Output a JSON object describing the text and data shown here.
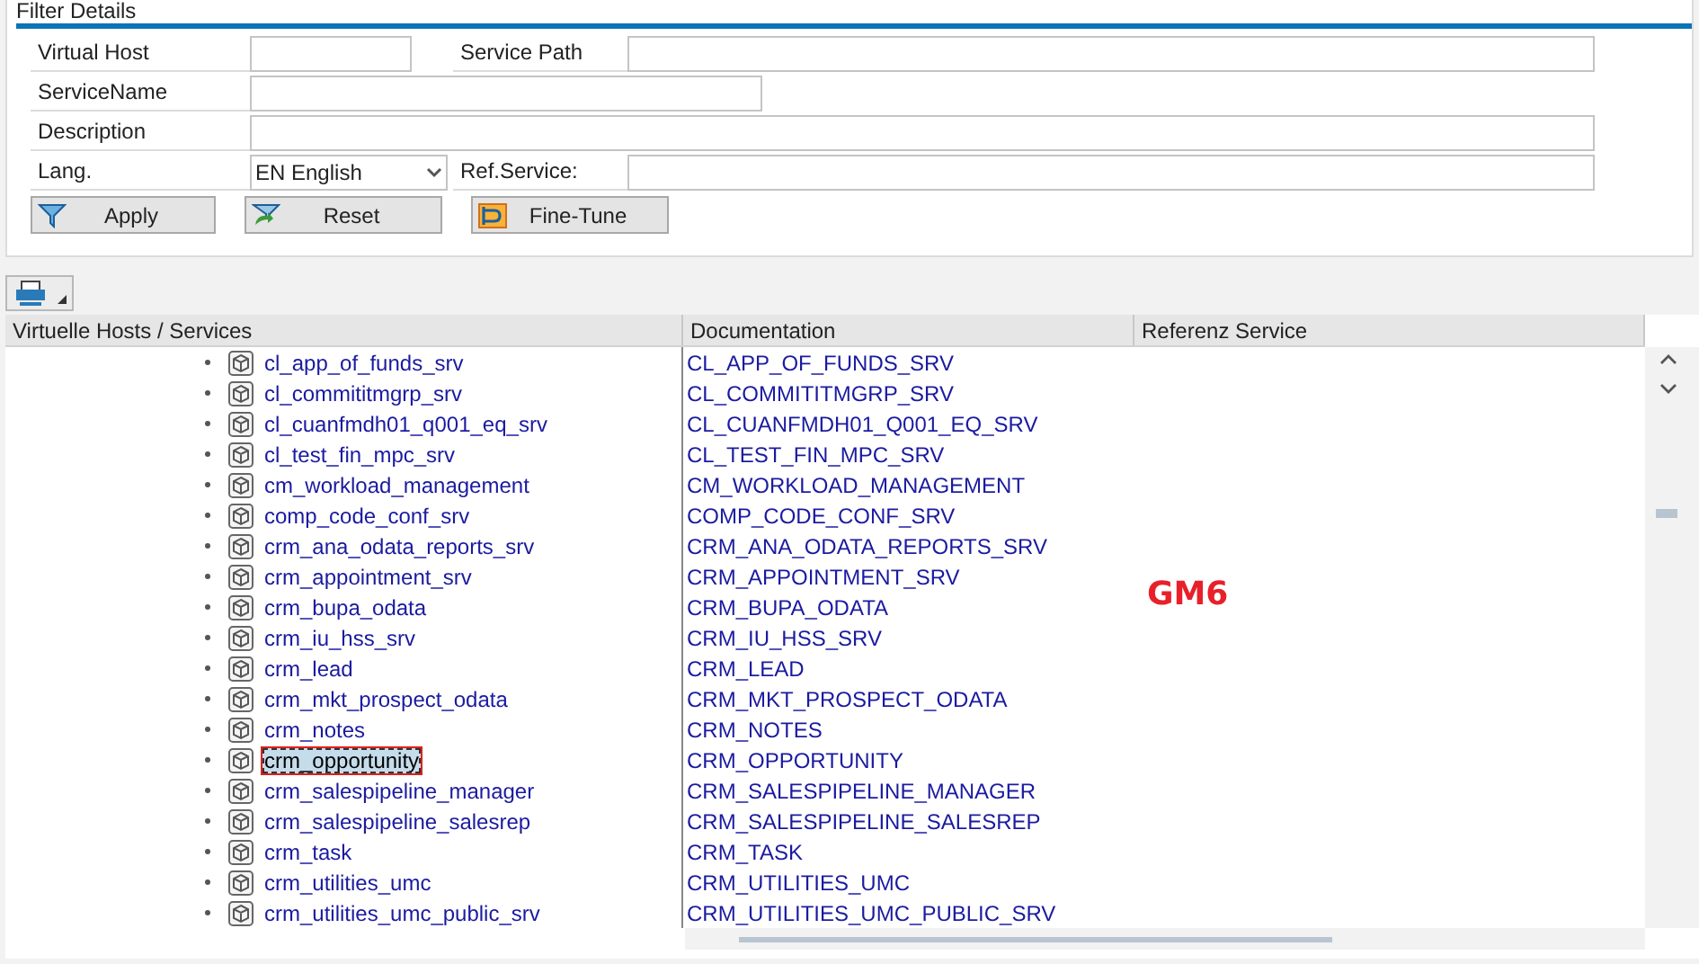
{
  "filter_panel": {
    "title": "Filter Details",
    "virtual_host": {
      "label": "Virtual Host"
    },
    "service_path": {
      "label": "Service Path"
    },
    "service_name": {
      "label": "ServiceName"
    },
    "description": {
      "label": "Description"
    },
    "language": {
      "label": "Lang.",
      "value": "EN English"
    },
    "ref_service": {
      "label": "Ref.Service:"
    },
    "buttons": [
      {
        "label": "Apply",
        "kind": "apply"
      },
      {
        "label": "Reset",
        "kind": "reset"
      },
      {
        "label": "Fine-Tune",
        "kind": "finetune"
      }
    ]
  },
  "table": {
    "columns": [
      "Virtuelle Hosts / Services",
      "Documentation",
      "Referenz Service"
    ],
    "rows": [
      {
        "service": "cl_app_of_funds_srv",
        "documentation": "CL_APP_OF_FUNDS_SRV",
        "selected": false
      },
      {
        "service": "cl_commititmgrp_srv",
        "documentation": "CL_COMMITITMGRP_SRV",
        "selected": false
      },
      {
        "service": "cl_cuanfmdh01_q001_eq_srv",
        "documentation": "CL_CUANFMDH01_Q001_EQ_SRV",
        "selected": false
      },
      {
        "service": "cl_test_fin_mpc_srv",
        "documentation": "CL_TEST_FIN_MPC_SRV",
        "selected": false
      },
      {
        "service": "cm_workload_management",
        "documentation": "CM_WORKLOAD_MANAGEMENT",
        "selected": false
      },
      {
        "service": "comp_code_conf_srv",
        "documentation": "COMP_CODE_CONF_SRV",
        "selected": false
      },
      {
        "service": "crm_ana_odata_reports_srv",
        "documentation": "CRM_ANA_ODATA_REPORTS_SRV",
        "selected": false
      },
      {
        "service": "crm_appointment_srv",
        "documentation": "CRM_APPOINTMENT_SRV",
        "selected": false
      },
      {
        "service": "crm_bupa_odata",
        "documentation": "CRM_BUPA_ODATA",
        "selected": false
      },
      {
        "service": "crm_iu_hss_srv",
        "documentation": "CRM_IU_HSS_SRV",
        "selected": false
      },
      {
        "service": "crm_lead",
        "documentation": "CRM_LEAD",
        "selected": false
      },
      {
        "service": "crm_mkt_prospect_odata",
        "documentation": "CRM_MKT_PROSPECT_ODATA",
        "selected": false
      },
      {
        "service": "crm_notes",
        "documentation": "CRM_NOTES",
        "selected": false
      },
      {
        "service": "crm_opportunity",
        "documentation": "CRM_OPPORTUNITY",
        "selected": true
      },
      {
        "service": "crm_salespipeline_manager",
        "documentation": "CRM_SALESPIPELINE_MANAGER",
        "selected": false
      },
      {
        "service": "crm_salespipeline_salesrep",
        "documentation": "CRM_SALESPIPELINE_SALESREP",
        "selected": false
      },
      {
        "service": "crm_task",
        "documentation": "CRM_TASK",
        "selected": false
      },
      {
        "service": "crm_utilities_umc",
        "documentation": "CRM_UTILITIES_UMC",
        "selected": false
      },
      {
        "service": "crm_utilities_umc_public_srv",
        "documentation": "CRM_UTILITIES_UMC_PUBLIC_SRV",
        "selected": false
      }
    ]
  },
  "annotation": "GM6"
}
